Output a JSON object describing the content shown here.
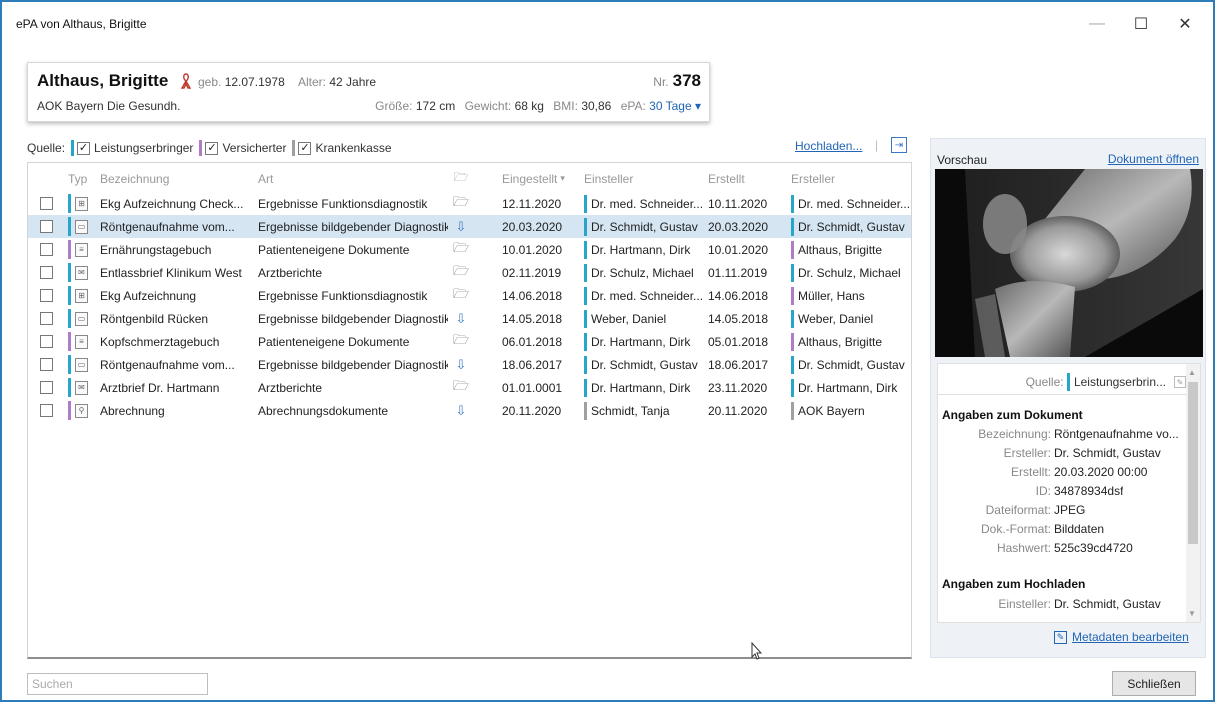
{
  "window": {
    "title": "ePA von Althaus, Brigitte",
    "controls": {
      "minimize": "—",
      "maximize": "☐",
      "close": "✕"
    }
  },
  "patient": {
    "name": "Althaus, Brigitte",
    "geb_label": "geb.",
    "geb_value": "12.07.1978",
    "alter_label": "Alter:",
    "alter_value": "42 Jahre",
    "nr_label": "Nr.",
    "nr_value": "378",
    "kasse": "AOK Bayern Die Gesundh.",
    "groesse_label": "Größe:",
    "groesse_value": "172 cm",
    "gewicht_label": "Gewicht:",
    "gewicht_value": "68 kg",
    "bmi_label": "BMI:",
    "bmi_value": "30,86",
    "epa_label": "ePA:",
    "epa_value": "30 Tage ▾",
    "ribbon_color": "#c0392b"
  },
  "sources": {
    "label": "Quelle:",
    "items": [
      {
        "label": "Leistungserbringer",
        "checked": "✓",
        "color": "#27a6c9"
      },
      {
        "label": "Versicherter",
        "checked": "✓",
        "color": "#b07bc9"
      },
      {
        "label": "Krankenkasse",
        "checked": "✓",
        "color": "#a0a0a0"
      }
    ],
    "upload_label": "Hochladen...",
    "upload_sep": "|",
    "upload_icon": "⇥"
  },
  "table": {
    "headers": {
      "typ": "Typ",
      "bezeichnung": "Bezeichnung",
      "art": "Art",
      "status_icon": "🗁",
      "eingestellt": "Eingestellt",
      "sort": "▾",
      "einsteller": "Einsteller",
      "erstellt": "Erstellt",
      "ersteller": "Ersteller"
    },
    "rows": [
      {
        "typ_icon": "ekg-icon",
        "typ_glyph": "⊞",
        "bez": "Ekg Aufzeichnung Check...",
        "art": "Ergebnisse Funktionsdiagnostik",
        "st_icon": "folder-icon",
        "st_glyph": "🗁",
        "eingestellt": "12.11.2020",
        "einsteller": "Dr. med. Schneider...",
        "erstellt": "10.11.2020",
        "ersteller": "Dr. med. Schneider...",
        "typ_color": "#27a6c9",
        "einst_color": "#27a6c9",
        "erst_color": "#27a6c9"
      },
      {
        "typ_icon": "image-icon",
        "typ_glyph": "▭",
        "bez": "Röntgenaufnahme vom...",
        "art": "Ergebnisse bildgebender Diagnostik",
        "st_icon": "upload-icon",
        "st_glyph": "⇩",
        "eingestellt": "20.03.2020",
        "einsteller": "Dr. Schmidt, Gustav",
        "erstellt": "20.03.2020",
        "ersteller": "Dr. Schmidt, Gustav",
        "typ_color": "#27a6c9",
        "einst_color": "#27a6c9",
        "erst_color": "#27a6c9"
      },
      {
        "typ_icon": "document-icon",
        "typ_glyph": "≡",
        "bez": "Ernährungstagebuch",
        "art": "Patienteneigene Dokumente",
        "st_icon": "folder-icon",
        "st_glyph": "🗁",
        "eingestellt": "10.01.2020",
        "einsteller": "Dr. Hartmann, Dirk",
        "erstellt": "10.01.2020",
        "ersteller": "Althaus, Brigitte",
        "typ_color": "#b07bc9",
        "einst_color": "#27a6c9",
        "erst_color": "#b07bc9"
      },
      {
        "typ_icon": "letter-icon",
        "typ_glyph": "✉",
        "bez": "Entlassbrief Klinikum West",
        "art": "Arztberichte",
        "st_icon": "folder-icon",
        "st_glyph": "🗁",
        "eingestellt": "02.11.2019",
        "einsteller": "Dr. Schulz, Michael",
        "erstellt": "01.11.2019",
        "ersteller": "Dr. Schulz, Michael",
        "typ_color": "#27a6c9",
        "einst_color": "#27a6c9",
        "erst_color": "#27a6c9"
      },
      {
        "typ_icon": "ekg-icon",
        "typ_glyph": "⊞",
        "bez": "Ekg Aufzeichnung",
        "art": "Ergebnisse Funktionsdiagnostik",
        "st_icon": "folder-icon",
        "st_glyph": "🗁",
        "eingestellt": "14.06.2018",
        "einsteller": "Dr. med. Schneider...",
        "erstellt": "14.06.2018",
        "ersteller": "Müller, Hans",
        "typ_color": "#27a6c9",
        "einst_color": "#27a6c9",
        "erst_color": "#b07bc9"
      },
      {
        "typ_icon": "image-icon",
        "typ_glyph": "▭",
        "bez": "Röntgenbild Rücken",
        "art": "Ergebnisse bildgebender Diagnostik",
        "st_icon": "upload-icon",
        "st_glyph": "⇩",
        "eingestellt": "14.05.2018",
        "einsteller": "Weber, Daniel",
        "erstellt": "14.05.2018",
        "ersteller": "Weber, Daniel",
        "typ_color": "#27a6c9",
        "einst_color": "#27a6c9",
        "erst_color": "#27a6c9"
      },
      {
        "typ_icon": "document-icon",
        "typ_glyph": "≡",
        "bez": "Kopfschmerztagebuch",
        "art": "Patienteneigene Dokumente",
        "st_icon": "folder-icon",
        "st_glyph": "🗁",
        "eingestellt": "06.01.2018",
        "einsteller": "Dr. Hartmann, Dirk",
        "erstellt": "05.01.2018",
        "ersteller": "Althaus, Brigitte",
        "typ_color": "#b07bc9",
        "einst_color": "#27a6c9",
        "erst_color": "#b07bc9"
      },
      {
        "typ_icon": "image-icon",
        "typ_glyph": "▭",
        "bez": "Röntgenaufnahme vom...",
        "art": "Ergebnisse bildgebender Diagnostik",
        "st_icon": "upload-icon",
        "st_glyph": "⇩",
        "eingestellt": "18.06.2017",
        "einsteller": "Dr. Schmidt, Gustav",
        "erstellt": "18.06.2017",
        "ersteller": "Dr. Schmidt, Gustav",
        "typ_color": "#27a6c9",
        "einst_color": "#27a6c9",
        "erst_color": "#27a6c9"
      },
      {
        "typ_icon": "letter-icon",
        "typ_glyph": "✉",
        "bez": "Arztbrief Dr. Hartmann",
        "art": "Arztberichte",
        "st_icon": "folder-icon",
        "st_glyph": "🗁",
        "eingestellt": "01.01.0001",
        "einsteller": "Dr. Hartmann, Dirk",
        "erstellt": "23.11.2020",
        "ersteller": "Dr. Hartmann, Dirk",
        "typ_color": "#27a6c9",
        "einst_color": "#27a6c9",
        "erst_color": "#27a6c9"
      },
      {
        "typ_icon": "receipt-icon",
        "typ_glyph": "⚲",
        "bez": "Abrechnung",
        "art": "Abrechnungsdokumente",
        "st_icon": "upload-icon",
        "st_glyph": "⇩",
        "eingestellt": "20.11.2020",
        "einsteller": "Schmidt, Tanja",
        "erstellt": "20.11.2020",
        "ersteller": "AOK Bayern",
        "typ_color": "#b07bc9",
        "einst_color": "#a0a0a0",
        "erst_color": "#a0a0a0"
      }
    ],
    "selected_row_index": 1
  },
  "preview": {
    "title": "Vorschau",
    "open_link": "Dokument öffnen",
    "quelle_label": "Quelle:",
    "quelle_value": "Leistungserbrin...",
    "quelle_color": "#27a6c9",
    "section_document": "Angaben zum Dokument",
    "doc_fields": [
      {
        "label": "Bezeichnung:",
        "value": "Röntgenaufnahme vo..."
      },
      {
        "label": "Ersteller:",
        "value": "Dr. Schmidt, Gustav"
      },
      {
        "label": "Erstellt:",
        "value": "20.03.2020 00:00"
      },
      {
        "label": "ID:",
        "value": "34878934dsf"
      },
      {
        "label": "Dateiformat:",
        "value": "JPEG"
      },
      {
        "label": "Dok.-Format:",
        "value": "Bilddaten"
      },
      {
        "label": "Hashwert:",
        "value": "525c39cd4720"
      }
    ],
    "section_upload": "Angaben zum Hochladen",
    "upload_fields": [
      {
        "label": "Einsteller:",
        "value": "Dr. Schmidt, Gustav"
      }
    ],
    "edit_metadata": "Metadaten bearbeiten"
  },
  "footer": {
    "search_placeholder": "Suchen",
    "close_label": "Schließen"
  }
}
